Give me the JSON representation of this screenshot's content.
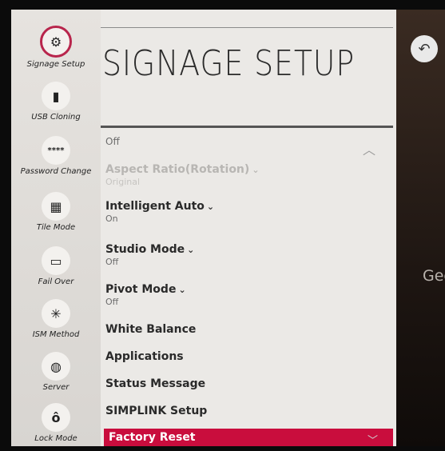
{
  "title": "SIGNAGE SETUP",
  "background_text": "Geer",
  "back_icon": "back-arrow-icon",
  "sidebar": {
    "items": [
      {
        "label": "Signage Setup",
        "icon": "signage-setup-icon",
        "glyph": "⚙",
        "active": true
      },
      {
        "label": "USB Cloning",
        "icon": "usb-cloning-icon",
        "glyph": "▮"
      },
      {
        "label": "Password Change",
        "icon": "password-icon",
        "glyph": "****"
      },
      {
        "label": "Tile Mode",
        "icon": "tile-mode-icon",
        "glyph": "▦"
      },
      {
        "label": "Fail Over",
        "icon": "fail-over-icon",
        "glyph": "▭"
      },
      {
        "label": "ISM Method",
        "icon": "ism-method-icon",
        "glyph": "✳"
      },
      {
        "label": "Server",
        "icon": "server-icon",
        "glyph": "◍"
      },
      {
        "label": "Lock Mode",
        "icon": "lock-icon",
        "glyph": "ô"
      }
    ]
  },
  "menu": {
    "top_value": "Off",
    "items": [
      {
        "label": "Aspect Ratio(Rotation)",
        "value": "Original",
        "dropdown": true,
        "disabled": true
      },
      {
        "label": "Intelligent Auto",
        "value": "On",
        "dropdown": true
      },
      {
        "label": "Studio Mode",
        "value": "Off",
        "dropdown": true
      },
      {
        "label": "Pivot Mode",
        "value": "Off",
        "dropdown": true
      },
      {
        "label": "White Balance"
      },
      {
        "label": "Applications"
      },
      {
        "label": "Status Message"
      },
      {
        "label": "SIMPLINK Setup"
      },
      {
        "label": "Factory Reset",
        "selected": true
      }
    ]
  },
  "colors": {
    "accent": "#c90d3d",
    "panel": "#ebe9e6",
    "sidebar": "#dedbd7"
  }
}
